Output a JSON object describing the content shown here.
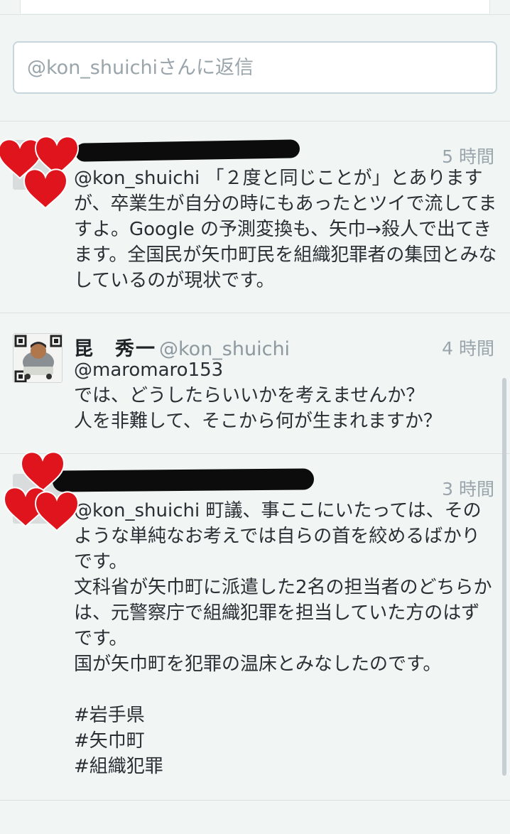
{
  "reply": {
    "placeholder": "@kon_shuichiさんに返信"
  },
  "tweets": [
    {
      "name": "",
      "handle": "",
      "time": "5 時間",
      "body": "@kon_shuichi 「２度と同じことが」とありますが、卒業生が自分の時にもあったとツイで流してますよ。Google の予測変換も、矢巾→殺人で出てきます。全国民が矢巾町民を組織犯罪者の集団とみなしているのが現状です。",
      "decoration": "heart-stickers"
    },
    {
      "name": "昆　秀一",
      "handle": "@kon_shuichi",
      "time": "4 時間",
      "body": "@maromaro153\nでは、どうしたらいいかを考えませんか？\n人を非難して、そこから何が生まれますか？"
    },
    {
      "name": "",
      "handle": "",
      "time": "3 時間",
      "body": "@kon_shuichi 町議、事ここにいたっては、そのような単純なお考えでは自らの首を絞めるばかりです。\n文科省が矢巾町に派遣した2名の担当者のどちらかは、元警察庁で組織犯罪を担当していた方のはずです。\n国が矢巾町を犯罪の温床とみなしたのです。\n\n#岩手県\n#矢巾町\n#組織犯罪",
      "decoration": "heart-stickers"
    }
  ],
  "colors": {
    "background": "#f1f5f4",
    "text": "#2a2f33",
    "muted": "#9aa5ab",
    "heart": "#e0141c"
  }
}
